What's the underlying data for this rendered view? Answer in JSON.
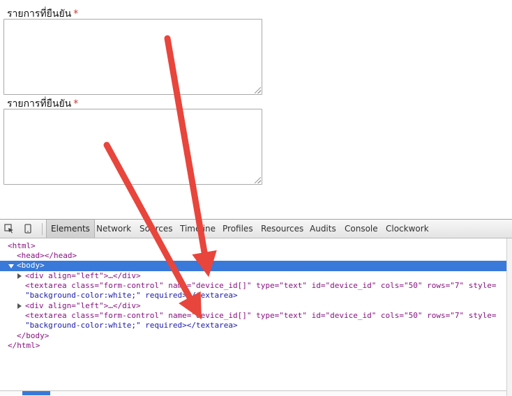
{
  "form": {
    "fields": [
      {
        "label": "รายการที่ยืนยัน",
        "required_mark": "*"
      },
      {
        "label": "รายการที่ยืนยัน",
        "required_mark": "*"
      }
    ]
  },
  "devtools": {
    "toolbar_icons": [
      "inspect-element-icon",
      "device-mode-icon"
    ],
    "tabs": [
      "Elements",
      "Network",
      "Sources",
      "Timeline",
      "Profiles",
      "Resources",
      "Audits",
      "Console",
      "Clockwork"
    ],
    "active_tab": "Elements",
    "dom": {
      "html_open": "<html>",
      "head": "<head></head>",
      "body_open": "<body>",
      "div1": "<div align=\"left\">…</div>",
      "textarea1_a": "<textarea class=\"form-control\" name=\"device_id[]\" type=\"text\" id=\"device_id\" cols=\"50\" rows=\"7\" style=",
      "textarea1_b": "\"background-color:white;\" required></textarea>",
      "div2": "<div align=\"left\">…</div>",
      "textarea2_a": "<textarea class=\"form-control\" name=\"device_id[]\" type=\"text\" id=\"device_id\" cols=\"50\" rows=\"7\" style=",
      "textarea2_b": "\"background-color:white;\" required></textarea>",
      "body_close": "</body>",
      "html_close": "</html>"
    }
  },
  "colors": {
    "arrow": "#e8453c",
    "selection": "#3879d9",
    "required": "#d9302c"
  }
}
